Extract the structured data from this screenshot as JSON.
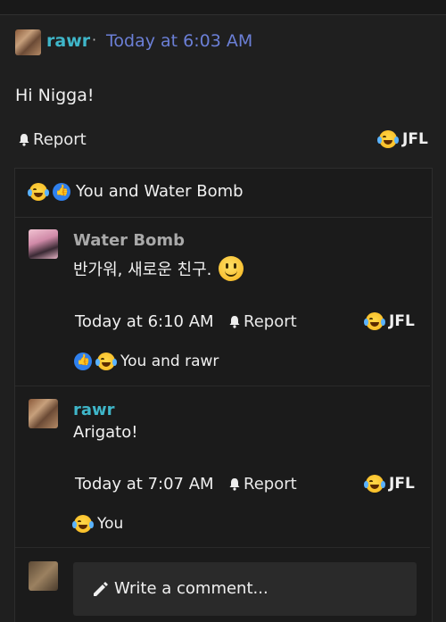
{
  "post": {
    "author": "rawr",
    "separator": "·",
    "time": "Today at 6:03 AM",
    "body": "Hi Nigga!",
    "report_label": "Report",
    "reaction_label": "JFL"
  },
  "comments": {
    "summary_text": "You and Water Bomb",
    "items": [
      {
        "author": "Water Bomb",
        "text": "반가워, 새로운 친구.",
        "time": "Today at 6:10 AM",
        "report_label": "Report",
        "reaction_label": "JFL",
        "reactions_text": "You and rawr"
      },
      {
        "author": "rawr",
        "text": "Arigato!",
        "time": "Today at 7:07 AM",
        "report_label": "Report",
        "reaction_label": "JFL",
        "reactions_text": "You"
      }
    ],
    "write_placeholder": "Write a comment..."
  },
  "icons": {
    "report": "bell-icon",
    "laugh": "laughing-tears-emoji",
    "like": "thumbs-up-emoji",
    "smile": "smile-emoji",
    "write": "pencil-icon"
  },
  "colors": {
    "author_link": "#3fb6c9",
    "timestamp_link": "#6b7fd6",
    "background": "#1f1f1f",
    "like_blue": "#2f80ed"
  }
}
